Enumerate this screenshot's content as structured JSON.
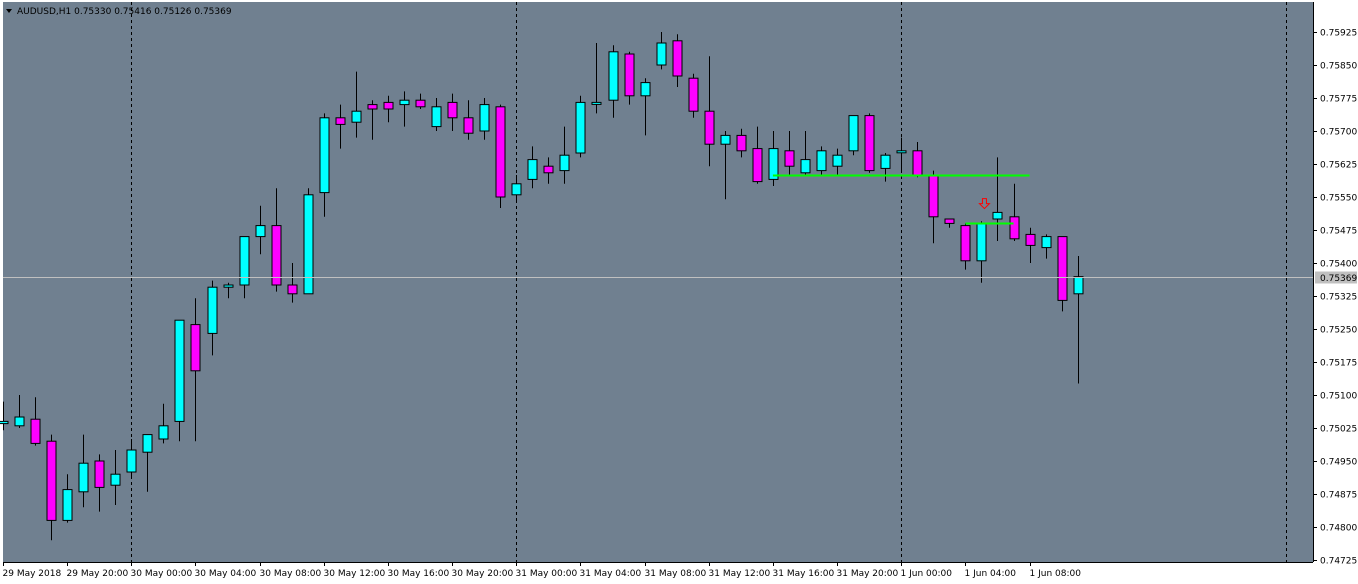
{
  "window": {
    "symbol_line": "AUDUSD,H1  0.75330 0.75416 0.75126 0.75369",
    "menu_icon": "triangle-down-icon"
  },
  "colors": {
    "background": "#708090",
    "bull": "#00ffff",
    "bear": "#ff00ff",
    "wick": "#000000",
    "level_line": "#00ff00",
    "bid_line": "#c0c0c0",
    "arrow": "#ff0000",
    "axis_bg": "#ffffff"
  },
  "current_price_label": "0.75369",
  "chart_data": {
    "type": "candlestick",
    "title": "AUDUSD,H1",
    "ylim": [
      0.747,
      0.76
    ],
    "y_ticks": [
      "0.75925",
      "0.75850",
      "0.75775",
      "0.75700",
      "0.75625",
      "0.75550",
      "0.75475",
      "0.75400",
      "0.75325",
      "0.75250",
      "0.75175",
      "0.75100",
      "0.75025",
      "0.74950",
      "0.74875",
      "0.74800",
      "0.74725"
    ],
    "x_tick_labels": [
      "29 May 2018",
      "29 May 20:00",
      "30 May 00:00",
      "30 May 04:00",
      "30 May 08:00",
      "30 May 12:00",
      "30 May 16:00",
      "30 May 20:00",
      "31 May 00:00",
      "31 May 04:00",
      "31 May 08:00",
      "31 May 12:00",
      "31 May 16:00",
      "31 May 20:00",
      "1 Jun 00:00",
      "1 Jun 04:00",
      "1 Jun 08:00"
    ],
    "x_tick_bar_index": [
      0,
      4,
      8,
      12,
      16,
      20,
      24,
      28,
      32,
      36,
      40,
      44,
      48,
      52,
      56,
      60,
      64
    ],
    "period_separator_bar_index": [
      8,
      32,
      56,
      80
    ],
    "current_price": 0.75369,
    "horizontal_levels": [
      {
        "price": 0.756,
        "from_bar": 48,
        "to_bar": 64
      },
      {
        "price": 0.7549,
        "from_bar": 60,
        "to_bar": 63
      }
    ],
    "arrow_marker": {
      "bar": 61,
      "price": 0.75535,
      "direction": "down"
    },
    "candles": [
      {
        "o": 0.75035,
        "h": 0.75085,
        "l": 0.7502,
        "c": 0.7504
      },
      {
        "o": 0.7503,
        "h": 0.751,
        "l": 0.75025,
        "c": 0.7505
      },
      {
        "o": 0.75045,
        "h": 0.75095,
        "l": 0.74985,
        "c": 0.7499
      },
      {
        "o": 0.74995,
        "h": 0.7501,
        "l": 0.7477,
        "c": 0.74815
      },
      {
        "o": 0.74815,
        "h": 0.7492,
        "l": 0.7481,
        "c": 0.74885
      },
      {
        "o": 0.7488,
        "h": 0.7501,
        "l": 0.74845,
        "c": 0.74945
      },
      {
        "o": 0.7495,
        "h": 0.74965,
        "l": 0.74835,
        "c": 0.7489
      },
      {
        "o": 0.74895,
        "h": 0.74975,
        "l": 0.7485,
        "c": 0.7492
      },
      {
        "o": 0.74925,
        "h": 0.75,
        "l": 0.74915,
        "c": 0.74975
      },
      {
        "o": 0.7497,
        "h": 0.7501,
        "l": 0.7488,
        "c": 0.7501
      },
      {
        "o": 0.75,
        "h": 0.7508,
        "l": 0.7499,
        "c": 0.7503
      },
      {
        "o": 0.7504,
        "h": 0.7516,
        "l": 0.74995,
        "c": 0.7527
      },
      {
        "o": 0.7526,
        "h": 0.7532,
        "l": 0.74995,
        "c": 0.75155
      },
      {
        "o": 0.7524,
        "h": 0.7536,
        "l": 0.7519,
        "c": 0.75345
      },
      {
        "o": 0.75345,
        "h": 0.75355,
        "l": 0.7532,
        "c": 0.7535
      },
      {
        "o": 0.7535,
        "h": 0.7542,
        "l": 0.7532,
        "c": 0.7546
      },
      {
        "o": 0.7546,
        "h": 0.7553,
        "l": 0.7542,
        "c": 0.75485
      },
      {
        "o": 0.75485,
        "h": 0.7557,
        "l": 0.75335,
        "c": 0.7535
      },
      {
        "o": 0.7535,
        "h": 0.754,
        "l": 0.7531,
        "c": 0.7533
      },
      {
        "o": 0.7533,
        "h": 0.7557,
        "l": 0.7533,
        "c": 0.75555
      },
      {
        "o": 0.7556,
        "h": 0.7574,
        "l": 0.75505,
        "c": 0.7573
      },
      {
        "o": 0.7573,
        "h": 0.7576,
        "l": 0.7566,
        "c": 0.75715
      },
      {
        "o": 0.7572,
        "h": 0.75835,
        "l": 0.75685,
        "c": 0.75745
      },
      {
        "o": 0.7576,
        "h": 0.7577,
        "l": 0.7568,
        "c": 0.7575
      },
      {
        "o": 0.75765,
        "h": 0.7578,
        "l": 0.7572,
        "c": 0.7575
      },
      {
        "o": 0.7576,
        "h": 0.7579,
        "l": 0.7571,
        "c": 0.7577
      },
      {
        "o": 0.7577,
        "h": 0.75785,
        "l": 0.7575,
        "c": 0.75755
      },
      {
        "o": 0.7571,
        "h": 0.75775,
        "l": 0.757,
        "c": 0.75755
      },
      {
        "o": 0.75765,
        "h": 0.75785,
        "l": 0.757,
        "c": 0.7573
      },
      {
        "o": 0.7573,
        "h": 0.7577,
        "l": 0.7568,
        "c": 0.75695
      },
      {
        "o": 0.757,
        "h": 0.75775,
        "l": 0.7568,
        "c": 0.7576
      },
      {
        "o": 0.75755,
        "h": 0.7576,
        "l": 0.75525,
        "c": 0.7555
      },
      {
        "o": 0.75555,
        "h": 0.756,
        "l": 0.7554,
        "c": 0.7558
      },
      {
        "o": 0.7559,
        "h": 0.75665,
        "l": 0.7557,
        "c": 0.75635
      },
      {
        "o": 0.7562,
        "h": 0.7564,
        "l": 0.7558,
        "c": 0.75605
      },
      {
        "o": 0.7561,
        "h": 0.7571,
        "l": 0.7558,
        "c": 0.75645
      },
      {
        "o": 0.7565,
        "h": 0.7578,
        "l": 0.7564,
        "c": 0.75765
      },
      {
        "o": 0.75765,
        "h": 0.759,
        "l": 0.7574,
        "c": 0.75765
      },
      {
        "o": 0.7577,
        "h": 0.75895,
        "l": 0.7573,
        "c": 0.7588
      },
      {
        "o": 0.75875,
        "h": 0.7588,
        "l": 0.7576,
        "c": 0.7578
      },
      {
        "o": 0.7578,
        "h": 0.7582,
        "l": 0.7569,
        "c": 0.7581
      },
      {
        "o": 0.7585,
        "h": 0.75925,
        "l": 0.7584,
        "c": 0.759
      },
      {
        "o": 0.75905,
        "h": 0.7592,
        "l": 0.758,
        "c": 0.75825
      },
      {
        "o": 0.7582,
        "h": 0.7583,
        "l": 0.7573,
        "c": 0.75745
      },
      {
        "o": 0.75745,
        "h": 0.7587,
        "l": 0.7562,
        "c": 0.7567
      },
      {
        "o": 0.7567,
        "h": 0.757,
        "l": 0.75545,
        "c": 0.7569
      },
      {
        "o": 0.7569,
        "h": 0.75705,
        "l": 0.7564,
        "c": 0.75655
      },
      {
        "o": 0.7566,
        "h": 0.7571,
        "l": 0.7558,
        "c": 0.75585
      },
      {
        "o": 0.7559,
        "h": 0.757,
        "l": 0.75575,
        "c": 0.7566
      },
      {
        "o": 0.75655,
        "h": 0.757,
        "l": 0.756,
        "c": 0.7562
      },
      {
        "o": 0.75605,
        "h": 0.757,
        "l": 0.756,
        "c": 0.75635
      },
      {
        "o": 0.7561,
        "h": 0.75665,
        "l": 0.756,
        "c": 0.75655
      },
      {
        "o": 0.7562,
        "h": 0.7566,
        "l": 0.756,
        "c": 0.75645
      },
      {
        "o": 0.75655,
        "h": 0.75735,
        "l": 0.75645,
        "c": 0.75735
      },
      {
        "o": 0.75735,
        "h": 0.7574,
        "l": 0.75605,
        "c": 0.7561
      },
      {
        "o": 0.75615,
        "h": 0.7565,
        "l": 0.75585,
        "c": 0.75645
      },
      {
        "o": 0.75655,
        "h": 0.75685,
        "l": 0.75605,
        "c": 0.75655
      },
      {
        "o": 0.75655,
        "h": 0.75675,
        "l": 0.75595,
        "c": 0.756
      },
      {
        "o": 0.756,
        "h": 0.7561,
        "l": 0.75445,
        "c": 0.75505
      },
      {
        "o": 0.755,
        "h": 0.755,
        "l": 0.7548,
        "c": 0.7549
      },
      {
        "o": 0.75485,
        "h": 0.7549,
        "l": 0.75385,
        "c": 0.75405
      },
      {
        "o": 0.75405,
        "h": 0.75495,
        "l": 0.75355,
        "c": 0.7549
      },
      {
        "o": 0.755,
        "h": 0.7564,
        "l": 0.7545,
        "c": 0.75515
      },
      {
        "o": 0.75505,
        "h": 0.7558,
        "l": 0.7545,
        "c": 0.75455
      },
      {
        "o": 0.75465,
        "h": 0.7548,
        "l": 0.754,
        "c": 0.7544
      },
      {
        "o": 0.75435,
        "h": 0.75465,
        "l": 0.7541,
        "c": 0.7546
      },
      {
        "o": 0.7546,
        "h": 0.7546,
        "l": 0.7529,
        "c": 0.75315
      },
      {
        "o": 0.7533,
        "h": 0.75416,
        "l": 0.75126,
        "c": 0.75369
      }
    ]
  }
}
